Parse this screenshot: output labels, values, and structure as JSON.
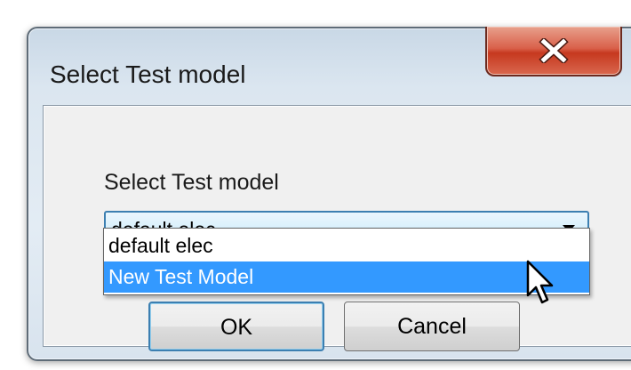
{
  "window": {
    "title": "Select Test model",
    "close_icon": "close-x-icon",
    "close_color": "#c6381f"
  },
  "form": {
    "field_label": "Select Test model",
    "combo_value": "default elec",
    "dropdown_icon": "chevron-down-icon"
  },
  "dropdown": {
    "items": [
      {
        "label": "default elec",
        "highlighted": false
      },
      {
        "label": "New Test Model",
        "highlighted": true
      }
    ],
    "highlight_color": "#3399ff"
  },
  "buttons": {
    "ok_label": "OK",
    "cancel_label": "Cancel"
  },
  "cursor": {
    "icon": "mouse-pointer-icon"
  }
}
